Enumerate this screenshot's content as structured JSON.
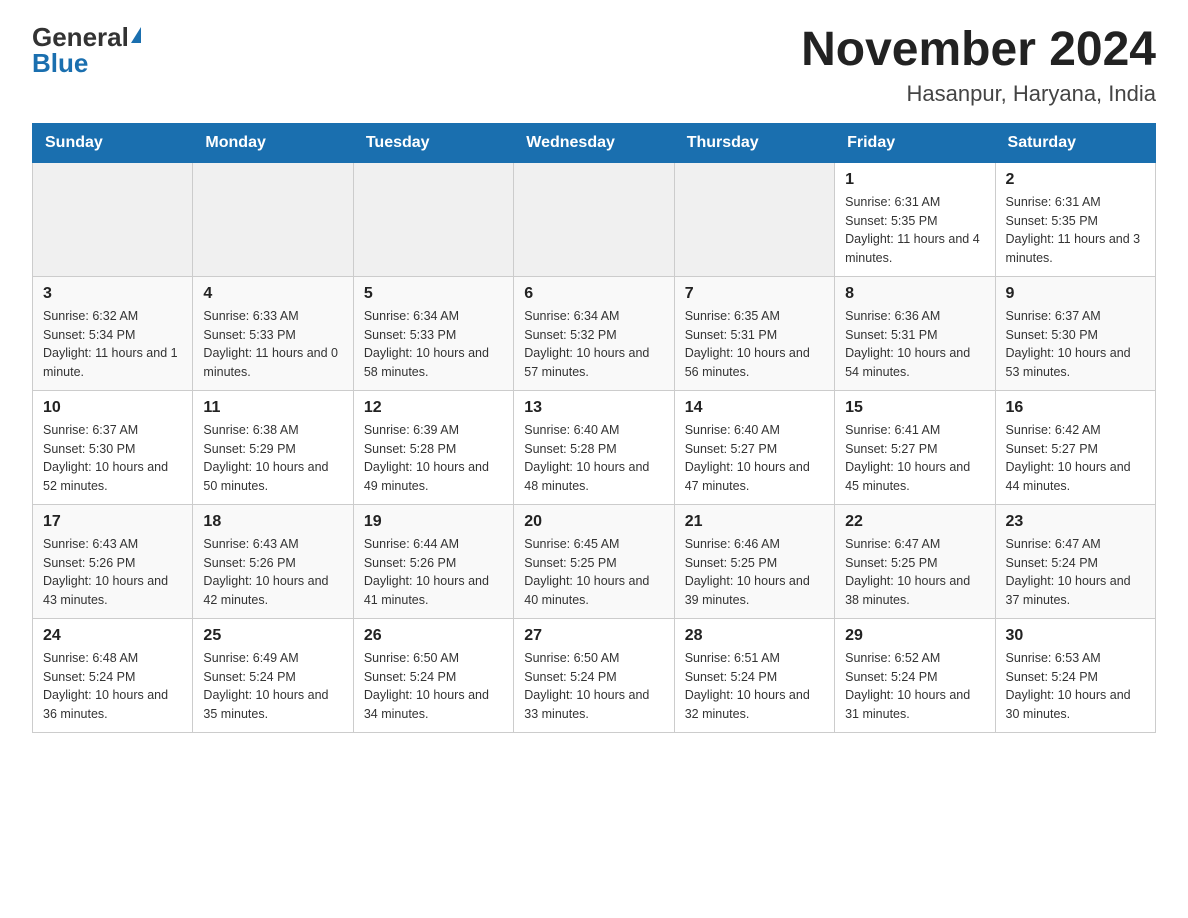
{
  "header": {
    "logo_general": "General",
    "logo_blue": "Blue",
    "title": "November 2024",
    "subtitle": "Hasanpur, Haryana, India"
  },
  "weekdays": [
    "Sunday",
    "Monday",
    "Tuesday",
    "Wednesday",
    "Thursday",
    "Friday",
    "Saturday"
  ],
  "weeks": [
    [
      {
        "day": "",
        "info": ""
      },
      {
        "day": "",
        "info": ""
      },
      {
        "day": "",
        "info": ""
      },
      {
        "day": "",
        "info": ""
      },
      {
        "day": "",
        "info": ""
      },
      {
        "day": "1",
        "info": "Sunrise: 6:31 AM\nSunset: 5:35 PM\nDaylight: 11 hours and 4 minutes."
      },
      {
        "day": "2",
        "info": "Sunrise: 6:31 AM\nSunset: 5:35 PM\nDaylight: 11 hours and 3 minutes."
      }
    ],
    [
      {
        "day": "3",
        "info": "Sunrise: 6:32 AM\nSunset: 5:34 PM\nDaylight: 11 hours and 1 minute."
      },
      {
        "day": "4",
        "info": "Sunrise: 6:33 AM\nSunset: 5:33 PM\nDaylight: 11 hours and 0 minutes."
      },
      {
        "day": "5",
        "info": "Sunrise: 6:34 AM\nSunset: 5:33 PM\nDaylight: 10 hours and 58 minutes."
      },
      {
        "day": "6",
        "info": "Sunrise: 6:34 AM\nSunset: 5:32 PM\nDaylight: 10 hours and 57 minutes."
      },
      {
        "day": "7",
        "info": "Sunrise: 6:35 AM\nSunset: 5:31 PM\nDaylight: 10 hours and 56 minutes."
      },
      {
        "day": "8",
        "info": "Sunrise: 6:36 AM\nSunset: 5:31 PM\nDaylight: 10 hours and 54 minutes."
      },
      {
        "day": "9",
        "info": "Sunrise: 6:37 AM\nSunset: 5:30 PM\nDaylight: 10 hours and 53 minutes."
      }
    ],
    [
      {
        "day": "10",
        "info": "Sunrise: 6:37 AM\nSunset: 5:30 PM\nDaylight: 10 hours and 52 minutes."
      },
      {
        "day": "11",
        "info": "Sunrise: 6:38 AM\nSunset: 5:29 PM\nDaylight: 10 hours and 50 minutes."
      },
      {
        "day": "12",
        "info": "Sunrise: 6:39 AM\nSunset: 5:28 PM\nDaylight: 10 hours and 49 minutes."
      },
      {
        "day": "13",
        "info": "Sunrise: 6:40 AM\nSunset: 5:28 PM\nDaylight: 10 hours and 48 minutes."
      },
      {
        "day": "14",
        "info": "Sunrise: 6:40 AM\nSunset: 5:27 PM\nDaylight: 10 hours and 47 minutes."
      },
      {
        "day": "15",
        "info": "Sunrise: 6:41 AM\nSunset: 5:27 PM\nDaylight: 10 hours and 45 minutes."
      },
      {
        "day": "16",
        "info": "Sunrise: 6:42 AM\nSunset: 5:27 PM\nDaylight: 10 hours and 44 minutes."
      }
    ],
    [
      {
        "day": "17",
        "info": "Sunrise: 6:43 AM\nSunset: 5:26 PM\nDaylight: 10 hours and 43 minutes."
      },
      {
        "day": "18",
        "info": "Sunrise: 6:43 AM\nSunset: 5:26 PM\nDaylight: 10 hours and 42 minutes."
      },
      {
        "day": "19",
        "info": "Sunrise: 6:44 AM\nSunset: 5:26 PM\nDaylight: 10 hours and 41 minutes."
      },
      {
        "day": "20",
        "info": "Sunrise: 6:45 AM\nSunset: 5:25 PM\nDaylight: 10 hours and 40 minutes."
      },
      {
        "day": "21",
        "info": "Sunrise: 6:46 AM\nSunset: 5:25 PM\nDaylight: 10 hours and 39 minutes."
      },
      {
        "day": "22",
        "info": "Sunrise: 6:47 AM\nSunset: 5:25 PM\nDaylight: 10 hours and 38 minutes."
      },
      {
        "day": "23",
        "info": "Sunrise: 6:47 AM\nSunset: 5:24 PM\nDaylight: 10 hours and 37 minutes."
      }
    ],
    [
      {
        "day": "24",
        "info": "Sunrise: 6:48 AM\nSunset: 5:24 PM\nDaylight: 10 hours and 36 minutes."
      },
      {
        "day": "25",
        "info": "Sunrise: 6:49 AM\nSunset: 5:24 PM\nDaylight: 10 hours and 35 minutes."
      },
      {
        "day": "26",
        "info": "Sunrise: 6:50 AM\nSunset: 5:24 PM\nDaylight: 10 hours and 34 minutes."
      },
      {
        "day": "27",
        "info": "Sunrise: 6:50 AM\nSunset: 5:24 PM\nDaylight: 10 hours and 33 minutes."
      },
      {
        "day": "28",
        "info": "Sunrise: 6:51 AM\nSunset: 5:24 PM\nDaylight: 10 hours and 32 minutes."
      },
      {
        "day": "29",
        "info": "Sunrise: 6:52 AM\nSunset: 5:24 PM\nDaylight: 10 hours and 31 minutes."
      },
      {
        "day": "30",
        "info": "Sunrise: 6:53 AM\nSunset: 5:24 PM\nDaylight: 10 hours and 30 minutes."
      }
    ]
  ]
}
